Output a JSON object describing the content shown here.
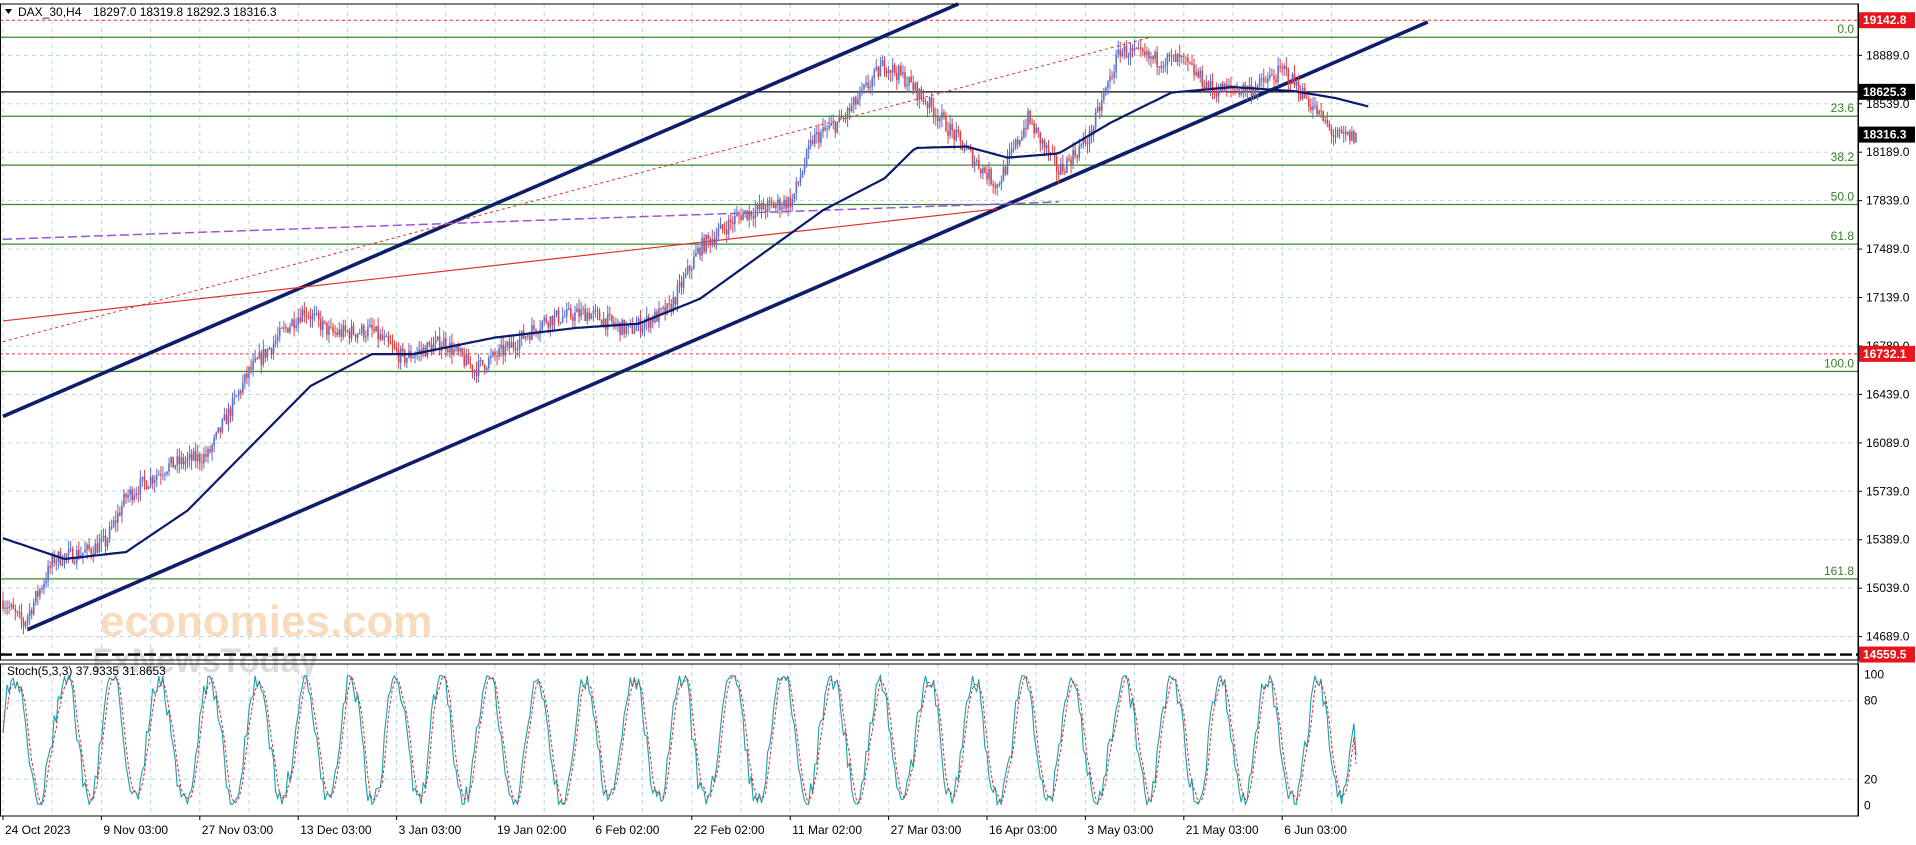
{
  "header": {
    "symbol_label": "DAX_30,H4",
    "ohlc": "18297.0 18319.8 18292.3 18316.3"
  },
  "watermark": {
    "brand": "economies.com",
    "sub": "FxNewsToday"
  },
  "colors": {
    "bull": "#5a6fd0",
    "bear": "#e04040",
    "ma": "#0a1a6e",
    "channel": "#101d6b",
    "fib": "#3a8a2a",
    "trend_red": "#e03030",
    "purple": "#9a55d8",
    "tag_red": "#e8141e",
    "tag_black": "#000000",
    "stoch_main": "#1aa0a8",
    "stoch_signal": "#d8303a"
  },
  "chart_data": [
    {
      "type": "candlestick",
      "title": "DAX_30,H4",
      "ohlc_last": {
        "open": 18297.0,
        "high": 18319.8,
        "low": 18292.3,
        "close": 18316.3
      },
      "ylim": [
        14520,
        19260
      ],
      "y_ticks": [
        14689.0,
        15039.0,
        15389.0,
        15739.0,
        16089.0,
        16439.0,
        16789.0,
        17139.0,
        17489.0,
        17839.0,
        18189.0,
        18539.0,
        18889.0
      ],
      "y_tick_labels": [
        "14689.0",
        "15039.0",
        "15389.0",
        "15739.0",
        "16089.0",
        "16439.0",
        "16789.0",
        "17139.0",
        "17489.0",
        "17839.0",
        "18189.0",
        "18539.0",
        "18889.0"
      ],
      "x_tick_labels": [
        "24 Oct 2023",
        "9 Nov 03:00",
        "27 Nov 03:00",
        "13 Dec 03:00",
        "3 Jan 03:00",
        "19 Jan 02:00",
        "6 Feb 02:00",
        "22 Feb 02:00",
        "11 Mar 02:00",
        "27 Mar 03:00",
        "16 Apr 03:00",
        "3 May 03:00",
        "21 May 03:00",
        "6 Jun 03:00"
      ],
      "x_tick_bars": [
        0,
        48,
        96,
        144,
        192,
        240,
        288,
        336,
        384,
        432,
        480,
        528,
        576,
        624
      ],
      "price_path": [
        [
          0,
          14950
        ],
        [
          10,
          14780
        ],
        [
          25,
          15250
        ],
        [
          40,
          15300
        ],
        [
          50,
          15370
        ],
        [
          60,
          15700
        ],
        [
          80,
          15920
        ],
        [
          100,
          16000
        ],
        [
          120,
          16600
        ],
        [
          140,
          16950
        ],
        [
          147,
          17050
        ],
        [
          160,
          16880
        ],
        [
          180,
          16900
        ],
        [
          195,
          16700
        ],
        [
          215,
          16820
        ],
        [
          230,
          16620
        ],
        [
          245,
          16760
        ],
        [
          265,
          16980
        ],
        [
          285,
          17030
        ],
        [
          305,
          16900
        ],
        [
          325,
          17050
        ],
        [
          340,
          17500
        ],
        [
          360,
          17740
        ],
        [
          385,
          17840
        ],
        [
          395,
          18280
        ],
        [
          410,
          18430
        ],
        [
          430,
          18830
        ],
        [
          440,
          18720
        ],
        [
          455,
          18480
        ],
        [
          470,
          18200
        ],
        [
          485,
          17950
        ],
        [
          500,
          18430
        ],
        [
          515,
          18050
        ],
        [
          530,
          18300
        ],
        [
          545,
          18930
        ],
        [
          560,
          18860
        ],
        [
          575,
          18850
        ],
        [
          590,
          18640
        ],
        [
          610,
          18650
        ],
        [
          625,
          18780
        ],
        [
          640,
          18500
        ],
        [
          650,
          18300
        ],
        [
          660,
          18300
        ]
      ],
      "ma_path": [
        [
          0,
          15400
        ],
        [
          30,
          15250
        ],
        [
          60,
          15300
        ],
        [
          90,
          15600
        ],
        [
          120,
          16050
        ],
        [
          150,
          16500
        ],
        [
          180,
          16730
        ],
        [
          200,
          16730
        ],
        [
          240,
          16850
        ],
        [
          280,
          16920
        ],
        [
          310,
          16950
        ],
        [
          340,
          17130
        ],
        [
          370,
          17450
        ],
        [
          400,
          17770
        ],
        [
          430,
          18000
        ],
        [
          445,
          18220
        ],
        [
          470,
          18230
        ],
        [
          490,
          18150
        ],
        [
          515,
          18180
        ],
        [
          540,
          18400
        ],
        [
          570,
          18620
        ],
        [
          600,
          18660
        ],
        [
          630,
          18630
        ],
        [
          650,
          18580
        ],
        [
          666,
          18520
        ]
      ],
      "stochastic": {
        "label": "Stoch(5,3,3) 37.9335 31.8653",
        "main": 37.9335,
        "signal": 31.8653,
        "ylim": [
          -8,
          108
        ],
        "levels": [
          20,
          80
        ],
        "y_tick_labels": [
          "0",
          "20",
          "80",
          "100"
        ],
        "y_tick_values": [
          0,
          20,
          80,
          100
        ]
      },
      "fibonacci": [
        {
          "label": "0.0",
          "price": 19020
        },
        {
          "label": "23.6",
          "price": 18449
        },
        {
          "label": "38.2",
          "price": 18096
        },
        {
          "label": "50.0",
          "price": 17811
        },
        {
          "label": "61.8",
          "price": 17525
        },
        {
          "label": "100.0",
          "price": 16605
        },
        {
          "label": "161.8",
          "price": 15106
        }
      ],
      "price_tags": [
        {
          "label": "19142.8",
          "price": 19142.8,
          "style": "red"
        },
        {
          "label": "18625.3",
          "price": 18625.3,
          "style": "black"
        },
        {
          "label": "18316.3",
          "price": 18316.3,
          "style": "black"
        },
        {
          "label": "16732.1",
          "price": 16732.1,
          "style": "red"
        },
        {
          "label": "14559.5",
          "price": 14559.5,
          "style": "red"
        }
      ],
      "horizontal_levels": [
        {
          "price": 19142.8,
          "style": "red-dotted"
        },
        {
          "price": 18625.3,
          "style": "black"
        },
        {
          "price": 16732.1,
          "style": "red-dotted"
        },
        {
          "price": 14559.5,
          "style": "black-thick"
        }
      ],
      "trendlines": [
        {
          "name": "channel-upper",
          "from": [
            0,
            16280
          ],
          "to": [
            466,
            19260
          ],
          "style": "channel"
        },
        {
          "name": "channel-lower",
          "from": [
            12,
            14740
          ],
          "to": [
            695,
            19130
          ],
          "style": "channel"
        },
        {
          "name": "red-dotted-trend",
          "from": [
            0,
            16820
          ],
          "to": [
            560,
            19020
          ],
          "style": "red-dotted"
        },
        {
          "name": "red-solid-trend",
          "from": [
            0,
            16970
          ],
          "to": [
            485,
            17780
          ],
          "style": "red-solid"
        },
        {
          "name": "purple-dashed",
          "from": [
            0,
            17560
          ],
          "to": [
            515,
            17830
          ],
          "style": "purple-dashed"
        }
      ]
    }
  ]
}
